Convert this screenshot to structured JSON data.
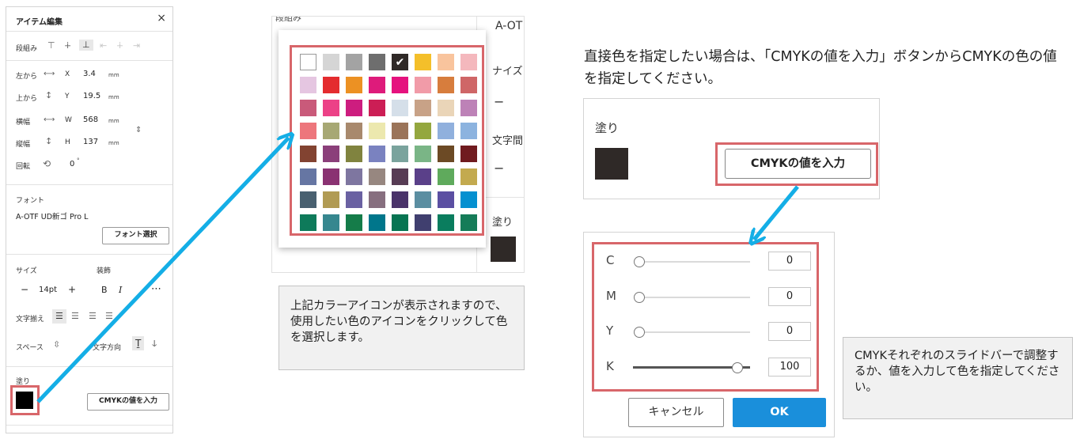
{
  "colors": {
    "highlight": "#d8666a",
    "arrow": "#14aee6",
    "ok_button": "#1a8fdb",
    "fill_swatch": "#2f2927",
    "left_fill_swatch": "#000000",
    "note_bg": "#f1f1f1"
  },
  "panel": {
    "title": "アイテム編集",
    "close": "×",
    "dangumi_label": "段組み",
    "pos": [
      {
        "label": "左から",
        "axis": "X",
        "value": "3.4",
        "unit": "mm",
        "icon": "⟷"
      },
      {
        "label": "上から",
        "axis": "Y",
        "value": "19.5",
        "unit": "mm",
        "icon": "↕"
      },
      {
        "label": "横幅",
        "axis": "W",
        "value": "568",
        "unit": "mm",
        "icon": "⟷"
      },
      {
        "label": "縦幅",
        "axis": "H",
        "value": "137",
        "unit": "mm",
        "icon": "↕"
      }
    ],
    "rotate_label": "回転",
    "rotate_value": "0",
    "rotate_unit": "°",
    "font_label": "フォント",
    "font_name": "A-OTF UD新ゴ Pro L",
    "font_button": "フォント選択",
    "size_label": "サイズ",
    "deco_label": "装飾",
    "size_value": "14pt",
    "size_minus": "−",
    "size_plus": "+",
    "bold": "B",
    "italic": "I",
    "more": "⋯",
    "align_label": "文字揃え",
    "space_label": "スペース",
    "direction_label": "文字方向",
    "fill_label": "塗り",
    "cmyk_button": "CMYKの値を入力"
  },
  "palette_bg": {
    "top_left_text": "段組み",
    "top_right_text": "A-OT",
    "size_text": "ナイズ",
    "spacing_text": "文字間",
    "fill_text": "塗り"
  },
  "palette": [
    [
      "#ffffff",
      "#d5d5d5",
      "#a3a3a3",
      "#6e6e6e",
      "#2f2927",
      "#f4bf2a",
      "#f9c49d",
      "#f4b8bd"
    ],
    [
      "#e5c6e1",
      "#e42c2f",
      "#ec9123",
      "#de1b7b",
      "#e5127e",
      "#f19ba8",
      "#d77d3d",
      "#cf6667"
    ],
    [
      "#c95a7a",
      "#ec4187",
      "#cd1d7f",
      "#cc1e55",
      "#d5dfe9",
      "#c8a287",
      "#ead5b8",
      "#bd82b7"
    ],
    [
      "#ed767c",
      "#a7a874",
      "#a8896d",
      "#ece8ae",
      "#9b7459",
      "#94a73f",
      "#90b0dd",
      "#8cb3df"
    ],
    [
      "#824331",
      "#8b3f7a",
      "#80833f",
      "#7a82c0",
      "#7aa39d",
      "#7ab586",
      "#6c4a25",
      "#701b1f"
    ],
    [
      "#6676a3",
      "#8a3272",
      "#7e76a0",
      "#978780",
      "#573c54",
      "#5a4089",
      "#5faa5c",
      "#c3aa4f"
    ],
    [
      "#496070",
      "#b19b54",
      "#6a61a2",
      "#876f7f",
      "#4a336a",
      "#5b8ea1",
      "#5b4fa2",
      "#0590d0"
    ],
    [
      "#0e7a5a",
      "#36878f",
      "#157c49",
      "#00768b",
      "#077452",
      "#403f6f",
      "#0a7d5e",
      "#157c58"
    ]
  ],
  "note1": "上記カラーアイコンが表示されますので、使用したい色のアイコンをクリックして色を選択します。",
  "instruction": "直接色を指定したい場合は、「CMYKの値を入力」ボタンからCMYKの色の値を指定してください。",
  "fill_card": {
    "label": "塗り",
    "button": "CMYKの値を入力"
  },
  "cmyk": {
    "channels": [
      {
        "name": "C",
        "value": "0",
        "level": 0
      },
      {
        "name": "M",
        "value": "0",
        "level": 0
      },
      {
        "name": "Y",
        "value": "0",
        "level": 0
      },
      {
        "name": "K",
        "value": "100",
        "level": 100
      }
    ],
    "cancel": "キャンセル",
    "ok": "OK"
  },
  "note2": "CMYKそれぞれのスライドバーで調整するか、値を入力して色を指定してください。"
}
